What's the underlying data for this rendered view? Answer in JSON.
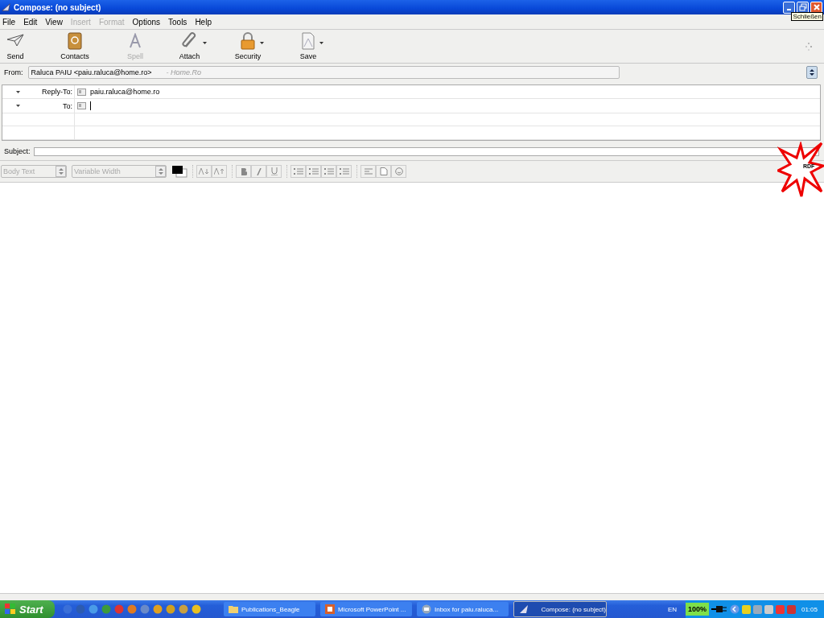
{
  "window": {
    "title": "Compose: (no subject)",
    "tooltip": "Schließen"
  },
  "menu": [
    {
      "label": "File",
      "disabled": false
    },
    {
      "label": "Edit",
      "disabled": false
    },
    {
      "label": "View",
      "disabled": false
    },
    {
      "label": "Insert",
      "disabled": true
    },
    {
      "label": "Format",
      "disabled": true
    },
    {
      "label": "Options",
      "disabled": false
    },
    {
      "label": "Tools",
      "disabled": false
    },
    {
      "label": "Help",
      "disabled": false
    }
  ],
  "toolbar": [
    {
      "kind": "send",
      "label": "Send",
      "disabled": false,
      "dropdown": false
    },
    {
      "kind": "contacts",
      "label": "Contacts",
      "disabled": false,
      "dropdown": false
    },
    {
      "kind": "spell",
      "label": "Spell",
      "disabled": true,
      "dropdown": false
    },
    {
      "kind": "attach",
      "label": "Attach",
      "disabled": false,
      "dropdown": true
    },
    {
      "kind": "security",
      "label": "Security",
      "disabled": false,
      "dropdown": true
    },
    {
      "kind": "save",
      "label": "Save",
      "disabled": false,
      "dropdown": true
    }
  ],
  "from": {
    "label": "From:",
    "value": "Raluca PAIU <paiu.raluca@home.ro>",
    "account": "- Home.Ro"
  },
  "addresses": [
    {
      "label": "Reply-To:",
      "value": "paiu.raluca@home.ro",
      "focused": false
    },
    {
      "label": "To:",
      "focused": true
    }
  ],
  "subject": {
    "label": "Subject:"
  },
  "format_bar": {
    "paragraph": "Body Text",
    "font": "Variable Width"
  },
  "sticker": {
    "text": "RDF"
  },
  "taskbar": {
    "start": "Start",
    "tasks": [
      {
        "kind": "folder",
        "label": "Publications_Beagle",
        "selected": false
      },
      {
        "kind": "powerpoint",
        "label": "Microsoft PowerPoint ...",
        "selected": false
      },
      {
        "kind": "mail",
        "label": "Inbox for paiu.raluca...",
        "selected": false
      },
      {
        "kind": "compose",
        "label": "Compose: (no subject)",
        "selected": true
      }
    ],
    "language": "EN",
    "battery": "100%",
    "clock": "01:05"
  }
}
